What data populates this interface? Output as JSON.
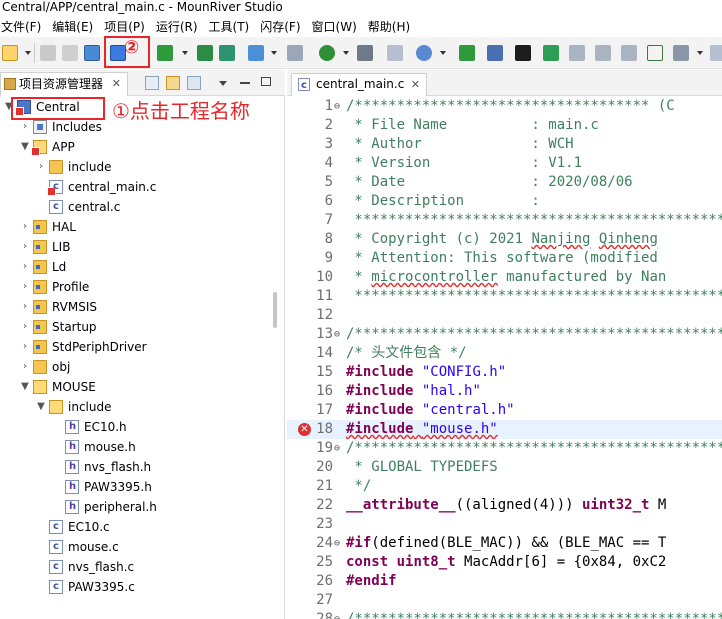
{
  "window": {
    "title": "Central/APP/central_main.c - MounRiver Studio"
  },
  "menu": [
    "文件(F)",
    "编辑(E)",
    "项目(P)",
    "运行(R)",
    "工具(T)",
    "闪存(F)",
    "窗口(W)",
    "帮助(H)"
  ],
  "annotations": {
    "step1": "①点击工程名称",
    "step2": "②"
  },
  "project_explorer": {
    "tab_label": "项目资源管理器",
    "close_glyph": "✕",
    "tree": [
      {
        "label": "Central",
        "indent": 0,
        "arrow": "▼",
        "icon": "proj"
      },
      {
        "label": "Includes",
        "indent": 1,
        "arrow": "›",
        "icon": "incl"
      },
      {
        "label": "APP",
        "indent": 1,
        "arrow": "▼",
        "icon": "folder-open"
      },
      {
        "label": "include",
        "indent": 2,
        "arrow": "›",
        "icon": "folder"
      },
      {
        "label": "central_main.c",
        "indent": 2,
        "arrow": "",
        "icon": "cfile"
      },
      {
        "label": "central.c",
        "indent": 2,
        "arrow": "",
        "icon": "cfile"
      },
      {
        "label": "HAL",
        "indent": 1,
        "arrow": "›",
        "icon": "srcfolder"
      },
      {
        "label": "LIB",
        "indent": 1,
        "arrow": "›",
        "icon": "srcfolder"
      },
      {
        "label": "Ld",
        "indent": 1,
        "arrow": "›",
        "icon": "srcfolder"
      },
      {
        "label": "Profile",
        "indent": 1,
        "arrow": "›",
        "icon": "srcfolder"
      },
      {
        "label": "RVMSIS",
        "indent": 1,
        "arrow": "›",
        "icon": "srcfolder"
      },
      {
        "label": "Startup",
        "indent": 1,
        "arrow": "›",
        "icon": "srcfolder"
      },
      {
        "label": "StdPeriphDriver",
        "indent": 1,
        "arrow": "›",
        "icon": "srcfolder"
      },
      {
        "label": "obj",
        "indent": 1,
        "arrow": "›",
        "icon": "folder"
      },
      {
        "label": "MOUSE",
        "indent": 1,
        "arrow": "▼",
        "icon": "folder-open"
      },
      {
        "label": "include",
        "indent": 2,
        "arrow": "▼",
        "icon": "folder-open"
      },
      {
        "label": "EC10.h",
        "indent": 3,
        "arrow": "",
        "icon": "hfile"
      },
      {
        "label": "mouse.h",
        "indent": 3,
        "arrow": "",
        "icon": "hfile"
      },
      {
        "label": "nvs_flash.h",
        "indent": 3,
        "arrow": "",
        "icon": "hfile"
      },
      {
        "label": "PAW3395.h",
        "indent": 3,
        "arrow": "",
        "icon": "hfile"
      },
      {
        "label": "peripheral.h",
        "indent": 3,
        "arrow": "",
        "icon": "hfile"
      },
      {
        "label": "EC10.c",
        "indent": 2,
        "arrow": "",
        "icon": "cfile"
      },
      {
        "label": "mouse.c",
        "indent": 2,
        "arrow": "",
        "icon": "cfile"
      },
      {
        "label": "nvs_flash.c",
        "indent": 2,
        "arrow": "",
        "icon": "cfile"
      },
      {
        "label": "PAW3395.c",
        "indent": 2,
        "arrow": "",
        "icon": "cfile"
      }
    ]
  },
  "editor": {
    "tab_label": "central_main.c",
    "close_glyph": "✕",
    "lines": [
      {
        "n": "1",
        "fold": "⊖",
        "html": "<span class=\"cm\">/*********************************** (C</span>"
      },
      {
        "n": "2",
        "fold": "",
        "html": "<span class=\"cm\"> * File Name          : main.c</span>"
      },
      {
        "n": "3",
        "fold": "",
        "html": "<span class=\"cm\"> * Author             : WCH</span>"
      },
      {
        "n": "4",
        "fold": "",
        "html": "<span class=\"cm\"> * Version            : V1.1</span>"
      },
      {
        "n": "5",
        "fold": "",
        "html": "<span class=\"cm\"> * Date               : 2020/08/06</span>"
      },
      {
        "n": "6",
        "fold": "",
        "html": "<span class=\"cm\"> * Description        :</span>"
      },
      {
        "n": "7",
        "fold": "",
        "html": "<span class=\"cm\"> **********************************************</span>"
      },
      {
        "n": "8",
        "fold": "",
        "html": "<span class=\"cm\"> * Copyright (c) 2021 <span class=\"under\">Nanjing</span> <span class=\"under\">Qinheng</span></span>"
      },
      {
        "n": "9",
        "fold": "",
        "html": "<span class=\"cm\"> * Attention: This software (modified</span>"
      },
      {
        "n": "10",
        "fold": "",
        "html": "<span class=\"cm\"> * <span class=\"under\">microcontroller</span> manufactured by Nan</span>"
      },
      {
        "n": "11",
        "fold": "",
        "html": "<span class=\"cm\"> **********************************************</span>"
      },
      {
        "n": "12",
        "fold": "",
        "html": ""
      },
      {
        "n": "13",
        "fold": "⊖",
        "html": "<span class=\"cm\">/**********************************************</span>"
      },
      {
        "n": "14",
        "fold": "",
        "html": "<span class=\"cm\">/* 头文件包含 */</span>"
      },
      {
        "n": "15",
        "fold": "",
        "html": "<span class=\"kw\">#include</span> <span class=\"str\">\"CONFIG.h\"</span>"
      },
      {
        "n": "16",
        "fold": "",
        "html": "<span class=\"kw\">#include</span> <span class=\"str\">\"hal.h\"</span>"
      },
      {
        "n": "17",
        "fold": "",
        "html": "<span class=\"kw\">#include</span> <span class=\"str\">\"central.h\"</span>"
      },
      {
        "n": "18",
        "fold": "",
        "err": true,
        "html": "<span class=\"under\"><span class=\"kw\">#include</span> <span class=\"str\">\"mouse.h\"</span></span>"
      },
      {
        "n": "19",
        "fold": "⊖",
        "html": "<span class=\"cm\">/**********************************************</span>"
      },
      {
        "n": "20",
        "fold": "",
        "html": "<span class=\"cm\"> * GLOBAL TYPEDEFS</span>"
      },
      {
        "n": "21",
        "fold": "",
        "html": "<span class=\"cm\"> */</span>"
      },
      {
        "n": "22",
        "fold": "",
        "html": "<span class=\"kw\">__attribute__</span>((aligned(4))) <span class=\"kw\">uint32_t</span> M"
      },
      {
        "n": "23",
        "fold": "",
        "html": ""
      },
      {
        "n": "24",
        "fold": "⊖",
        "html": "<span class=\"kw\">#if</span>(defined(BLE_MAC)) &amp;&amp; (BLE_MAC == T"
      },
      {
        "n": "25",
        "fold": "",
        "html": "<span class=\"kw\">const</span> <span class=\"kw\">uint8_t</span> MacAddr[6] = {0x84, 0xC2"
      },
      {
        "n": "26",
        "fold": "",
        "html": "<span class=\"kw\">#endif</span>"
      },
      {
        "n": "27",
        "fold": "",
        "html": ""
      },
      {
        "n": "28",
        "fold": "⊖",
        "html": "<span class=\"cm\">/**********************************************</span>"
      }
    ]
  },
  "colors": {
    "annotation_red": "#e8262a",
    "comment_green": "#3f7f5f",
    "keyword_purple": "#7f0055",
    "string_blue": "#2a00ff"
  }
}
